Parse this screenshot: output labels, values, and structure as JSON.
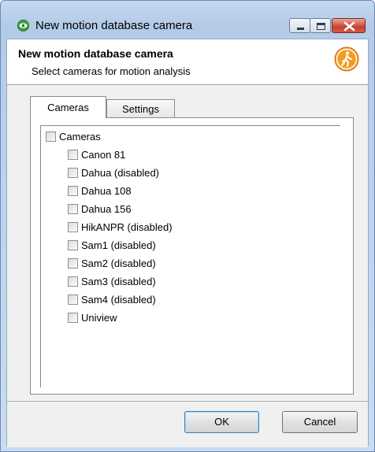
{
  "window": {
    "title": "New motion database camera",
    "app_icon": "eye-icon",
    "controls": [
      "minimize-icon",
      "maximize-icon",
      "close-icon"
    ]
  },
  "header": {
    "title": "New motion database camera",
    "subtitle": "Select cameras for motion analysis",
    "icon": "walking-person-icon",
    "icon_color": "#f39c21"
  },
  "tabs": [
    {
      "label": "Cameras",
      "selected": true
    },
    {
      "label": "Settings",
      "selected": false
    }
  ],
  "tree": {
    "root": {
      "label": "Cameras",
      "checked": false
    },
    "items": [
      {
        "label": "Canon 81",
        "checked": false
      },
      {
        "label": "Dahua (disabled)",
        "checked": false
      },
      {
        "label": "Dahua 108",
        "checked": false
      },
      {
        "label": "Dahua 156",
        "checked": false
      },
      {
        "label": "HikANPR (disabled)",
        "checked": false
      },
      {
        "label": "Sam1 (disabled)",
        "checked": false
      },
      {
        "label": "Sam2 (disabled)",
        "checked": false
      },
      {
        "label": "Sam3 (disabled)",
        "checked": false
      },
      {
        "label": "Sam4 (disabled)",
        "checked": false
      },
      {
        "label": "Uniview",
        "checked": false
      }
    ]
  },
  "buttons": {
    "ok": "OK",
    "cancel": "Cancel"
  }
}
